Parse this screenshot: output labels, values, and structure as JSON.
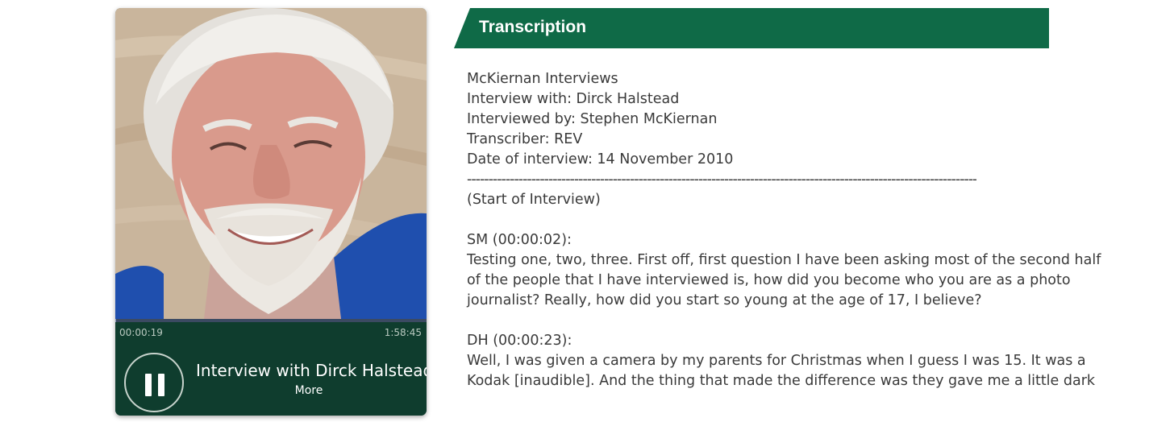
{
  "player": {
    "elapsed": "00:00:19",
    "total": "1:58:45",
    "progress_fraction": 0.003,
    "title": "Interview with Dirck Halstead",
    "more_label": "More"
  },
  "panel": {
    "title": "Transcription"
  },
  "transcript": {
    "meta": [
      "McKiernan Interviews",
      "Interview with: Dirck Halstead",
      "Interviewed by: Stephen McKiernan",
      "Transcriber: REV",
      "Date of interview: 14 November 2010"
    ],
    "divider": "----------------------------------------------------------------------------------------------------------------------------------------",
    "start": "(Start of Interview)",
    "blocks": [
      {
        "speaker": "SM (00:00:02):",
        "lines": [
          "Testing one, two, three. First off, first question I have been asking most of the second half",
          "of the people that I have interviewed is, how did you become who you are as a photo",
          "journalist? Really, how did you start so young at the age of 17, I believe?"
        ]
      },
      {
        "speaker": "DH (00:00:23):",
        "lines": [
          "Well, I was given a camera by my parents for Christmas when I guess I was 15. It was a",
          "Kodak [inaudible]. And the thing that made the difference was they gave me a little dark"
        ]
      }
    ]
  },
  "colors": {
    "header_green": "#0f6a47",
    "player_green": "#0f3d2e",
    "text": "#3a3a3a"
  },
  "icons": {
    "play_control": "pause-icon"
  }
}
